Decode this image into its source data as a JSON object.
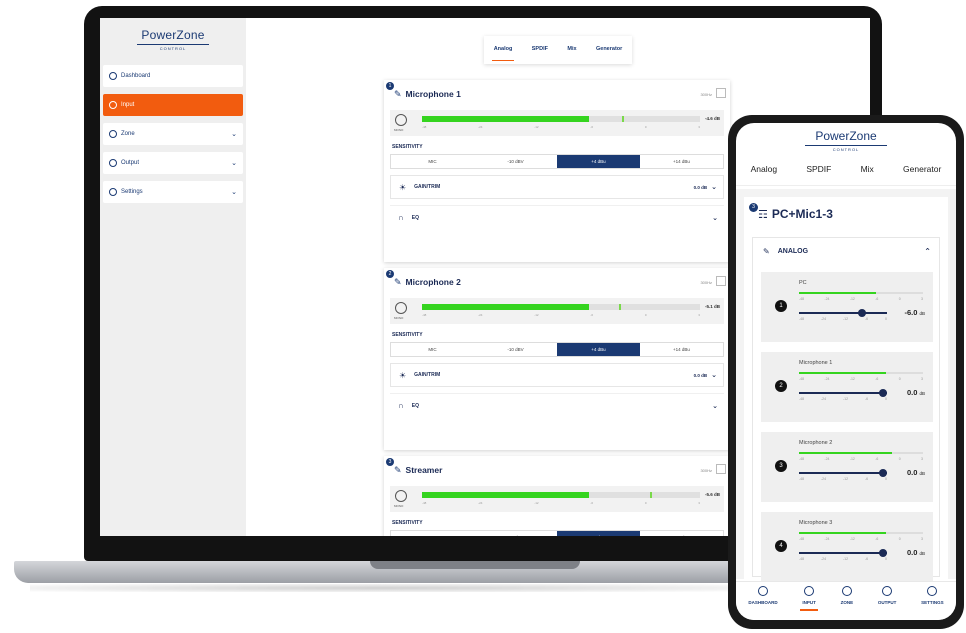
{
  "desktop": {
    "logo": {
      "word": "PowerZone",
      "sub": "CONTROL"
    },
    "nav": [
      {
        "label": "Dashboard",
        "icon": "dashboard-icon"
      },
      {
        "label": "Input",
        "icon": "input-icon",
        "active": true
      },
      {
        "label": "Zone",
        "icon": "zone-icon"
      },
      {
        "label": "Output",
        "icon": "output-icon"
      },
      {
        "label": "Settings",
        "icon": "settings-icon"
      }
    ],
    "tabs": [
      "Analog",
      "SPDIF",
      "Mix",
      "Generator"
    ],
    "active_tab": "Analog",
    "scale": [
      "-48",
      "-24",
      "-12",
      "-6",
      "0",
      "3"
    ],
    "sensitivity_label": "SENSITIVITY",
    "sensitivity_options": [
      "MIC",
      "-10 dBV",
      "+4 dBu",
      "+14 dBu"
    ],
    "mono_label": "MONO",
    "hz_label": "300Hz",
    "channels": [
      {
        "num": "1",
        "title": "Microphone 1",
        "level": 0.6,
        "peak": 0.72,
        "value": "-4.6 dB",
        "gain_label": "GAIN/TRIM",
        "gain_value": "0.0 dB",
        "eq_label": "EQ"
      },
      {
        "num": "2",
        "title": "Microphone 2",
        "level": 0.6,
        "peak": 0.71,
        "value": "-5.1 dB",
        "gain_label": "GAIN/TRIM",
        "gain_value": "0.0 dB",
        "eq_label": "EQ"
      },
      {
        "num": "3",
        "title": "Streamer",
        "level": 0.6,
        "peak": 0.82,
        "value": "-5.6 dB"
      }
    ]
  },
  "mobile": {
    "logo": {
      "word": "PowerZone",
      "sub": "CONTROL"
    },
    "tabs": [
      "Analog",
      "SPDIF",
      "Mix",
      "Generator"
    ],
    "active_tab": "Mix",
    "card_num": "3",
    "card_title": "PC+Mic1-3",
    "section_label": "ANALOG",
    "top_scale": [
      "-48",
      "-24",
      "-12",
      "-6",
      "0",
      "3"
    ],
    "fader_scale": [
      "-48",
      "-24",
      "-12",
      "-6",
      "0"
    ],
    "channels": [
      {
        "num": "1",
        "name": "PC",
        "level": 0.62,
        "fader": 0.72,
        "value": "-6.0",
        "unit": "dB"
      },
      {
        "num": "2",
        "name": "Microphone 1",
        "level": 0.7,
        "fader": 0.95,
        "value": "0.0",
        "unit": "dB"
      },
      {
        "num": "3",
        "name": "Microphone 2",
        "level": 0.75,
        "fader": 0.95,
        "value": "0.0",
        "unit": "dB"
      },
      {
        "num": "4",
        "name": "Microphone 3",
        "level": 0.7,
        "fader": 0.95,
        "value": "0.0",
        "unit": "dB"
      }
    ],
    "bottom_nav": [
      "DASHBOARD",
      "INPUT",
      "ZONE",
      "OUTPUT",
      "SETTINGS"
    ],
    "active_bottom": "INPUT"
  },
  "colors": {
    "accent": "#f25c0f",
    "navy": "#1b3a73",
    "meter": "#35d41f"
  }
}
